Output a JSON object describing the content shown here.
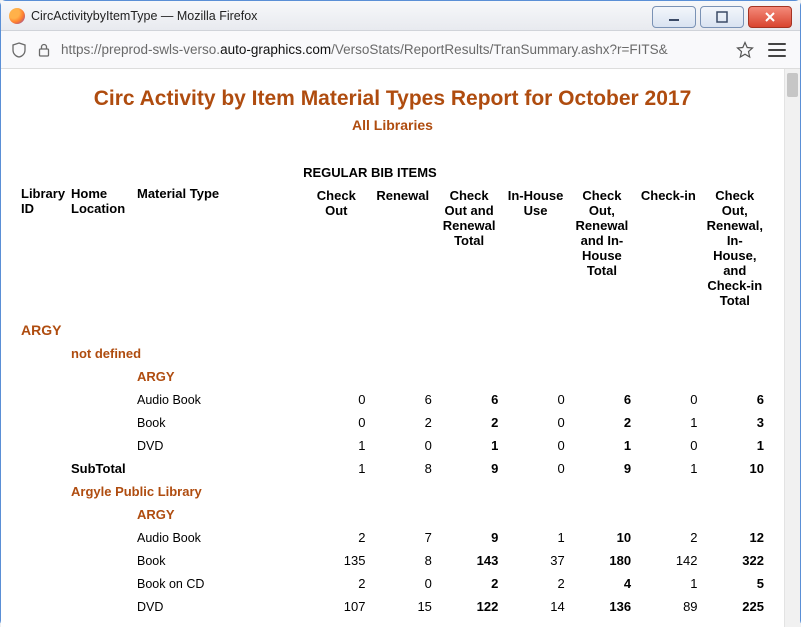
{
  "window": {
    "title": "CircActivitybyItemType — Mozilla Firefox"
  },
  "url": {
    "pre": "https://preprod-swls-verso.",
    "domain": "auto-graphics.com",
    "post": "/VersoStats/ReportResults/TranSummary.ashx?r=FITS&"
  },
  "report": {
    "title": "Circ Activity by Item Material Types Report for October 2017",
    "subtitle": "All Libraries"
  },
  "columns": {
    "library_id": "Library ID",
    "home_location": "Home Location",
    "bib_items": "REGULAR BIB ITEMS",
    "material_type": "Material Type",
    "check_out": "Check Out",
    "renewal": "Renewal",
    "co_renewal_total": "Check Out and Renewal Total",
    "in_house": "In-House Use",
    "co_ren_ih_total": "Check Out, Renewal and In-House Total",
    "check_in": "Check-in",
    "grand_total": "Check Out, Renewal, In-House, and Check-in Total"
  },
  "labels": {
    "subtotal": "SubTotal"
  },
  "libs": [
    {
      "id": "ARGY",
      "locations": [
        {
          "name": "not defined",
          "type_head": "ARGY",
          "rows": [
            {
              "mat": "Audio Book",
              "co": "0",
              "ren": "6",
              "cort": "6",
              "ih": "0",
              "crit": "6",
              "ci": "0",
              "gt": "6"
            },
            {
              "mat": "Book",
              "co": "0",
              "ren": "2",
              "cort": "2",
              "ih": "0",
              "crit": "2",
              "ci": "1",
              "gt": "3"
            },
            {
              "mat": "DVD",
              "co": "1",
              "ren": "0",
              "cort": "1",
              "ih": "0",
              "crit": "1",
              "ci": "0",
              "gt": "1"
            }
          ],
          "subtotal": {
            "co": "1",
            "ren": "8",
            "cort": "9",
            "ih": "0",
            "crit": "9",
            "ci": "1",
            "gt": "10"
          }
        },
        {
          "name": "Argyle Public Library",
          "type_head": "ARGY",
          "rows": [
            {
              "mat": "Audio Book",
              "co": "2",
              "ren": "7",
              "cort": "9",
              "ih": "1",
              "crit": "10",
              "ci": "2",
              "gt": "12"
            },
            {
              "mat": "Book",
              "co": "135",
              "ren": "8",
              "cort": "143",
              "ih": "37",
              "crit": "180",
              "ci": "142",
              "gt": "322"
            },
            {
              "mat": "Book on CD",
              "co": "2",
              "ren": "0",
              "cort": "2",
              "ih": "2",
              "crit": "4",
              "ci": "1",
              "gt": "5"
            },
            {
              "mat": "DVD",
              "co": "107",
              "ren": "15",
              "cort": "122",
              "ih": "14",
              "crit": "136",
              "ci": "89",
              "gt": "225"
            }
          ]
        }
      ]
    }
  ]
}
